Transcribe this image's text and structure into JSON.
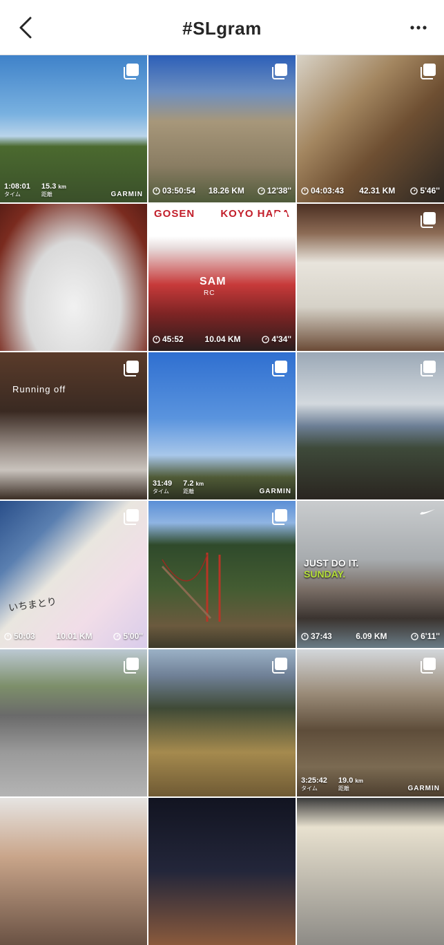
{
  "header": {
    "title": "#SLgram",
    "back_icon": "chevron-left-icon",
    "more_icon": "more-horizontal-icon"
  },
  "colors": {
    "header_text": "#262626",
    "divider": "#dbdbdb",
    "jdi_sunday": "#b6e03a",
    "sign_red": "#c21e2a"
  },
  "posts": [
    {
      "garmin": {
        "time": "1:08:01",
        "time_label": "タイム",
        "distance": "15.3",
        "distance_unit": "km",
        "distance_label": "距離",
        "brand": "GARMIN"
      }
    },
    {
      "stats": {
        "time": "03:50:54",
        "distance": "18.26 KM",
        "pace": "12'38''"
      }
    },
    {
      "stats": {
        "time": "04:03:43",
        "distance": "42.31 KM",
        "pace": "5'46''"
      }
    },
    {},
    {
      "sign": {
        "left": "GOSEN",
        "right": "KOYO HARA"
      },
      "shirt": "SAM",
      "shirt_sub": "RC",
      "stats": {
        "time": "45:52",
        "distance": "10.04 KM",
        "pace": "4'34''"
      }
    },
    {},
    {
      "overlay": "Running off"
    },
    {
      "garmin": {
        "time": "31:49",
        "time_label": "タイム",
        "distance": "7.2",
        "distance_unit": "km",
        "distance_label": "距離",
        "brand": "GARMIN"
      }
    },
    {},
    {
      "handwriting": "いちまとり",
      "stats": {
        "time": "50:03",
        "distance": "10.01 KM",
        "pace": "5'00''"
      }
    },
    {},
    {
      "jdi": {
        "line1": "JUST DO IT.",
        "line2": "SUNDAY."
      },
      "stats": {
        "time": "37:43",
        "distance": "6.09 KM",
        "pace": "6'11''"
      }
    },
    {},
    {},
    {
      "garmin": {
        "time": "3:25:42",
        "time_label": "タイム",
        "distance": "19.0",
        "distance_unit": "km",
        "distance_label": "距離",
        "brand": "GARMIN"
      }
    },
    {},
    {},
    {}
  ]
}
